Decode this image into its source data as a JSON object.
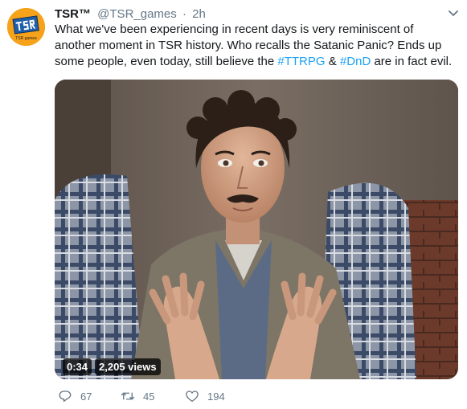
{
  "tweet": {
    "author_name": "TSR™",
    "handle": "@TSR_games",
    "separator": "·",
    "time": "2h",
    "text_before": "What we've been experiencing in recent days is very reminiscent of another moment in TSR history. Who recalls the Satanic Panic? Ends up some people, even today, still believe the ",
    "hashtag_1": "#TTRPG",
    "text_middle": " & ",
    "hashtag_2": "#DnD",
    "text_after": " are in fact evil.",
    "avatar_text": "TSR",
    "avatar_subtext": "TSR games"
  },
  "video": {
    "duration": "0:34",
    "views": "2,205 views"
  },
  "actions": {
    "replies": "67",
    "retweets": "45",
    "likes": "194"
  },
  "colors": {
    "link": "#1da1f2",
    "secondary": "#657786",
    "avatar_bg": "#f6a21a"
  },
  "icons": {
    "menu": "chevron-down-icon",
    "reply": "reply-icon",
    "retweet": "retweet-icon",
    "like": "heart-icon"
  }
}
